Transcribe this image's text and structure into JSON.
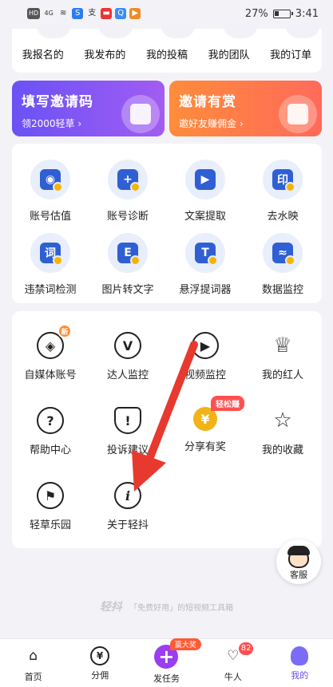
{
  "status_bar": {
    "left_icons": [
      "HD",
      "4G",
      "wifi-icon",
      "S",
      "支",
      "app",
      "Q",
      "play"
    ],
    "battery": "27%",
    "time": "3:41"
  },
  "top_tabs": [
    "我报名的",
    "我发布的",
    "我的投稿",
    "我的团队",
    "我的订单"
  ],
  "banners": {
    "invite_code": {
      "title": "填写邀请码",
      "subtitle": "领2000轻草 ›"
    },
    "invite_reward": {
      "title": "邀请有赏",
      "subtitle": "邀好友赚佣金 ›"
    }
  },
  "tools": [
    {
      "label": "账号估值",
      "glyph": "person-icon"
    },
    {
      "label": "账号诊断",
      "glyph": "shield-plus-icon"
    },
    {
      "label": "文案提取",
      "glyph": "video-clip-icon"
    },
    {
      "label": "去水映",
      "glyph": "stamp-icon"
    },
    {
      "label": "违禁词检测",
      "glyph": "text-check-icon"
    },
    {
      "label": "图片转文字",
      "glyph": "image-text-icon"
    },
    {
      "label": "悬浮提词器",
      "glyph": "teleprompter-icon"
    },
    {
      "label": "数据监控",
      "glyph": "monitor-chart-icon"
    }
  ],
  "services": [
    {
      "label": "自媒体账号",
      "icon": "tag-icon",
      "badge": "新"
    },
    {
      "label": "达人监控",
      "icon": "v-icon"
    },
    {
      "label": "视频监控",
      "icon": "play-icon"
    },
    {
      "label": "我的红人",
      "icon": "crown-icon"
    },
    {
      "label": "帮助中心",
      "icon": "question-icon"
    },
    {
      "label": "投诉建议",
      "icon": "shield-exclamation-icon"
    },
    {
      "label": "分享有奖",
      "icon": "yen-coin-icon",
      "tag": "轻松赚"
    },
    {
      "label": "我的收藏",
      "icon": "star-icon"
    },
    {
      "label": "轻草乐园",
      "icon": "flag-icon"
    },
    {
      "label": "关于轻抖",
      "icon": "info-icon"
    }
  ],
  "support": {
    "label": "客服"
  },
  "footer": {
    "brand": "轻抖",
    "slogan": "「免费好用」的短视频工具箱"
  },
  "bottom_nav": [
    {
      "label": "首页",
      "icon": "home-icon"
    },
    {
      "label": "分佣",
      "icon": "yen-icon",
      "symbol": "¥"
    },
    {
      "label": "发任务",
      "icon": "plus-icon",
      "symbol": "+",
      "badge": "赢大奖"
    },
    {
      "label": "牛人",
      "icon": "handshake-icon",
      "count": "82"
    },
    {
      "label": "我的",
      "icon": "mine-icon",
      "active": true
    }
  ],
  "colors": {
    "accent": "#6a4cf0",
    "invite_banner_start": "#6a52f5",
    "reward_banner_start": "#ff8c3b",
    "annotation_arrow": "#e8392f"
  }
}
